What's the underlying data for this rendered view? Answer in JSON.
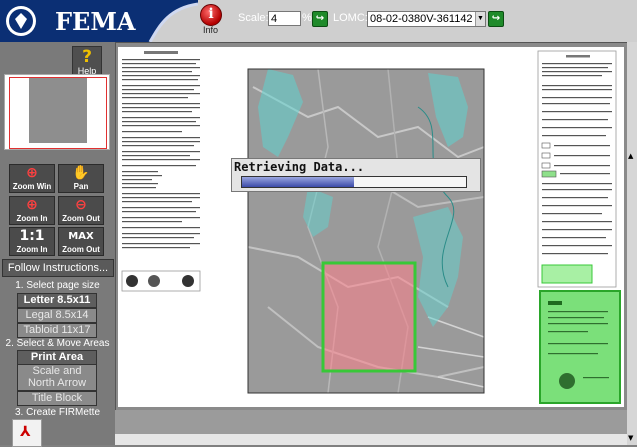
{
  "app": {
    "logo_text": "FEMA"
  },
  "toolbar": {
    "info_label": "Info",
    "scale_label": "Scale:",
    "scale_value": "4",
    "scale_unit": "%",
    "lomc_label": "LOMC:",
    "lomc_value": "08-02-0380V-361142"
  },
  "sidebar": {
    "help_label": "Help",
    "tools": [
      {
        "label": "Zoom Win",
        "icon": "zoom-window-icon"
      },
      {
        "label": "Pan",
        "icon": "hand-icon"
      },
      {
        "label": "Zoom In",
        "icon": "zoom-in-icon"
      },
      {
        "label": "Zoom Out",
        "icon": "zoom-out-icon"
      },
      {
        "label": "Zoom In",
        "big": "1:1"
      },
      {
        "label": "Zoom Out",
        "big": "MAX"
      }
    ],
    "follow_label": "Follow Instructions...",
    "step1": "1. Select page size",
    "page_sizes": [
      "Letter 8.5x11",
      "Legal 8.5x14",
      "Tabloid 11x17"
    ],
    "step2": "2. Select & Move Areas",
    "areas": [
      "Print Area",
      "Scale and North Arrow",
      "Title Block"
    ],
    "step3": "3. Create FIRMette"
  },
  "loading": {
    "text": "Retrieving Data...",
    "progress": 0.5
  },
  "colors": {
    "accent_blue": "#0b2f74",
    "go_green": "#1f8a2a",
    "flood_cyan": "#5fd3cf",
    "selection_red": "#ff7f8a",
    "selection_green": "#38c838"
  }
}
